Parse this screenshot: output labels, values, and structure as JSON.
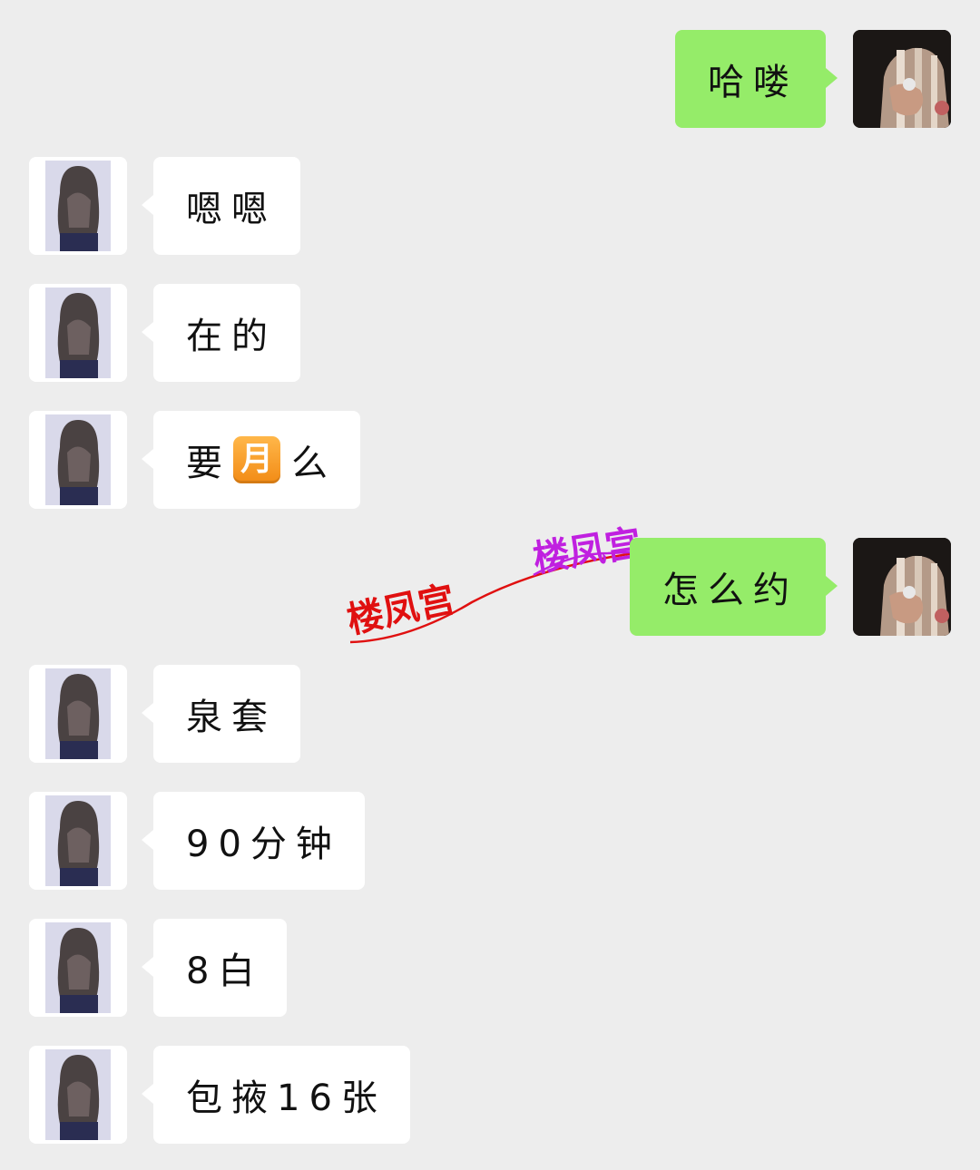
{
  "watermark": {
    "text_red": "楼凤宫",
    "text_purple": "楼凤宫",
    "color_red": "#e01010",
    "color_purple": "#c020e0"
  },
  "colors": {
    "background": "#ededed",
    "sent_bubble": "#95ec69",
    "received_bubble": "#ffffff"
  },
  "messages": [
    {
      "side": "right",
      "text": "哈喽"
    },
    {
      "side": "left",
      "text": "嗯嗯"
    },
    {
      "side": "left",
      "text": "在的"
    },
    {
      "side": "left",
      "pre": "要",
      "emoji": "月",
      "post": "么"
    },
    {
      "side": "right",
      "text": "怎么约"
    },
    {
      "side": "left",
      "text": "泉套"
    },
    {
      "side": "left",
      "text": "90分钟"
    },
    {
      "side": "left",
      "text": "8白"
    },
    {
      "side": "left",
      "text": "包掖16张"
    }
  ]
}
